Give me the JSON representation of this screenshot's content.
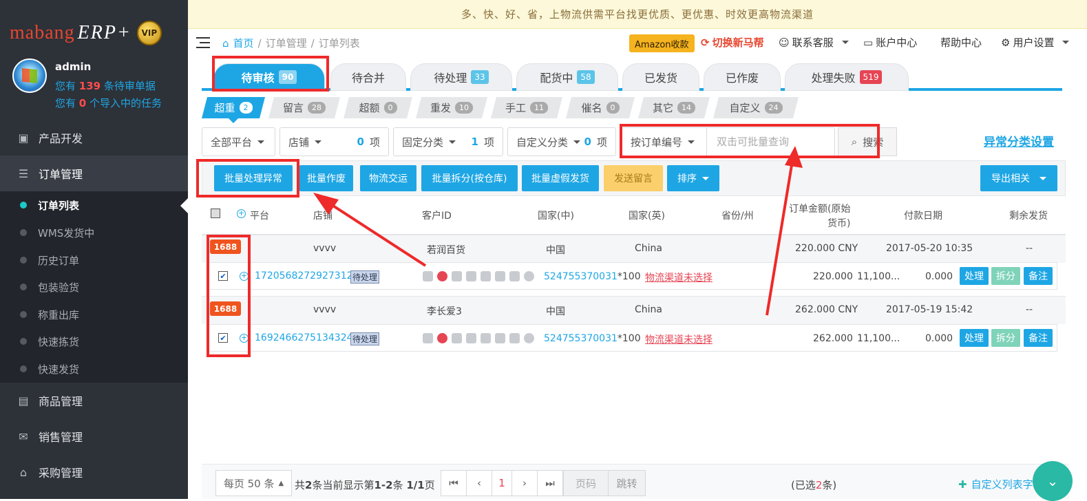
{
  "sidebar": {
    "logo_text": "mabang",
    "logo_suffix": "ERP+",
    "vip_label": "VIP",
    "user": {
      "name": "admin"
    },
    "pending_line": {
      "prefix": "您有",
      "count": "139",
      "suffix": "条待审单据"
    },
    "import_line": {
      "prefix": "您有",
      "count": "0",
      "suffix": "个导入中的任务"
    },
    "menu": [
      {
        "label": "产品开发",
        "icon": "product-icon"
      },
      {
        "label": "订单管理",
        "icon": "order-icon"
      },
      {
        "label": "商品管理",
        "icon": "goods-icon"
      },
      {
        "label": "销售管理",
        "icon": "sales-icon"
      },
      {
        "label": "采购管理",
        "icon": "purchase-icon"
      }
    ],
    "submenu": [
      "订单列表",
      "WMS发货中",
      "历史订单",
      "包装验货",
      "称重出库",
      "快速拣货",
      "快速发货"
    ]
  },
  "notice": "多、快、好、省，上物流供需平台找更优质、更优惠、时效更高物流渠道",
  "topbar": {
    "breadcrumb": [
      "首页",
      "订单管理",
      "订单列表"
    ],
    "amazon": "Amazon收款",
    "switch": "切换新马帮",
    "support": "联系客服",
    "account": "账户中心",
    "help": "帮助中心",
    "settings": "用户设置"
  },
  "tabs": [
    {
      "label": "待审核",
      "count": "90"
    },
    {
      "label": "待合并",
      "count": ""
    },
    {
      "label": "待处理",
      "count": "33"
    },
    {
      "label": "配货中",
      "count": "58"
    },
    {
      "label": "已发货",
      "count": ""
    },
    {
      "label": "已作废",
      "count": ""
    },
    {
      "label": "处理失败",
      "count": "519"
    }
  ],
  "subtabs": [
    {
      "label": "超重",
      "count": "2"
    },
    {
      "label": "留言",
      "count": "28"
    },
    {
      "label": "超额",
      "count": "0"
    },
    {
      "label": "重发",
      "count": "10"
    },
    {
      "label": "手工",
      "count": "11"
    },
    {
      "label": "催名",
      "count": "0"
    },
    {
      "label": "其它",
      "count": "14"
    },
    {
      "label": "自定义",
      "count": "24"
    }
  ],
  "filters": {
    "platform": "全部平台",
    "store": {
      "label": "店铺",
      "count": "0",
      "unit": "项"
    },
    "fixed": {
      "label": "固定分类",
      "count": "1",
      "unit": "项"
    },
    "custom": {
      "label": "自定义分类",
      "count": "0",
      "unit": "项"
    },
    "search_type": "按订单编号",
    "search_placeholder": "双击可批量查询",
    "search_btn": "搜索",
    "abnormal_settings": "异常分类设置"
  },
  "actions": [
    "批量处理异常",
    "批量作废",
    "物流交运",
    "批量拆分(按仓库)",
    "批量虚假发货",
    "发送留言",
    "排序"
  ],
  "export": "导出相关",
  "columns": [
    "平台",
    "店铺",
    "客户ID",
    "国家(中)",
    "国家(英)",
    "省份/州",
    "订单金额(原始",
    "货币)",
    "付款日期",
    "剩余发货"
  ],
  "orders": [
    {
      "platform": "1688",
      "store": "vvvv",
      "customer": "若润百货",
      "country_cn": "中国",
      "country_en": "China",
      "amount": "220.000 CNY",
      "pay_date": "2017-05-20 10:35",
      "remain": "--",
      "order_no": "17205682729273127",
      "status": "待处理",
      "sku": "524755370031",
      "qty": "*100",
      "logistics": "物流渠道未选择",
      "val1": "220.000",
      "val2": "11,100...",
      "val3": "0.000"
    },
    {
      "platform": "1688",
      "store": "vvvv",
      "customer": "李长爱3",
      "country_cn": "中国",
      "country_en": "China",
      "amount": "262.000 CNY",
      "pay_date": "2017-05-19 15:42",
      "remain": "--",
      "order_no": "16924662751343248",
      "status": "待处理",
      "sku": "524755370031",
      "qty": "*100",
      "logistics": "物流渠道未选择",
      "val1": "262.000",
      "val2": "11,100...",
      "val3": "0.000"
    }
  ],
  "row_actions": [
    "处理",
    "拆分",
    "备注"
  ],
  "pager": {
    "per_page": "每页 50 条",
    "summary_a": "共",
    "summary_total": "2",
    "summary_b": "条当前显示第",
    "summary_range": "1-2",
    "summary_c": "条",
    "summary_page": "1/1",
    "summary_d": "页",
    "current_page": "1",
    "page_input_placeholder": "页码",
    "jump": "跳转",
    "selected_a": "(已选",
    "selected_n": "2",
    "selected_b": "条)",
    "custom_fields": "自定义列表字段"
  }
}
